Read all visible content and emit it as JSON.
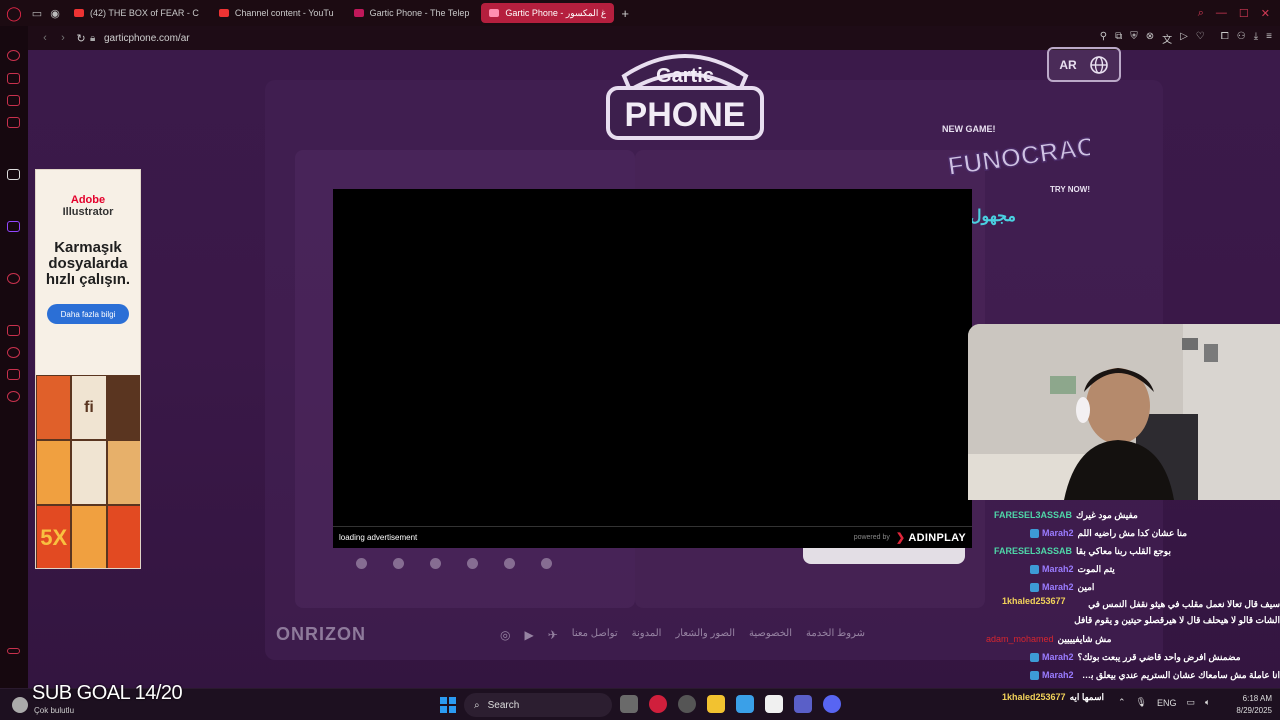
{
  "browser": {
    "tabs": [
      {
        "label": "(42) THE BOX of FEAR - C",
        "favicon": "youtube"
      },
      {
        "label": "Channel content - YouTu",
        "favicon": "youtube"
      },
      {
        "label": "Gartic Phone - The Telep",
        "favicon": "gartic"
      },
      {
        "label": "Gartic Phone - غ المكسور",
        "favicon": "gartic",
        "active": true
      }
    ],
    "url": "garticphone.com/ar"
  },
  "page": {
    "language_button": "AR",
    "logo_top": "Gartic",
    "logo_bottom": "PHONE",
    "promo": {
      "new_game": "NEW GAME!",
      "title": "FUNOCRACY",
      "cta": "TRY NOW!"
    },
    "arabic_name": "مجهول الهـ",
    "footer_brand": "ONRIZON",
    "footer_links": [
      "شروط الخدمة",
      "الخصوصية",
      "الصور والشعار",
      "المدونة",
      "تواصل معنا"
    ]
  },
  "side_ad": {
    "brand_line1": "Adobe",
    "brand_line2": "Illustrator",
    "headline": "Karmaşık dosyalarda hızlı çalışın.",
    "cta": "Daha fazla bilgi",
    "tile_labels": [
      "fi",
      "5X"
    ]
  },
  "video_ad": {
    "status": "loading advertisement",
    "powered_by": "powered by",
    "brand": "ADINPLAY"
  },
  "chat": [
    {
      "user": "FARESEL3ASSAB",
      "color": "#4fd6a8",
      "badge": false,
      "msg": "مفيش مود غيرك"
    },
    {
      "user": "Marah2",
      "color": "#9a7cff",
      "badge": true,
      "msg": "منا عشان كدا مش راضيه اللم"
    },
    {
      "user": "FARESEL3ASSAB",
      "color": "#4fd6a8",
      "badge": false,
      "msg": "بوجع القلب ربنا معاكي بقا"
    },
    {
      "user": "Marah2",
      "color": "#9a7cff",
      "badge": true,
      "msg": "يتم الموت"
    },
    {
      "user": "Marah2",
      "color": "#9a7cff",
      "badge": true,
      "msg": "امين"
    },
    {
      "user": "1khaled253677",
      "color": "#f2d25a",
      "badge": false,
      "msg": "سيف قال تعالا نعمل مقلب في هيثو نقفل النمس في الشات قالو لا هيحلف قال لا هيرقصلو حيتين و يقوم قافل"
    },
    {
      "user": "adam_mohamed",
      "color": "#d6262f",
      "badge": false,
      "msg": "مش شايفيييين"
    },
    {
      "user": "Marah2",
      "color": "#9a7cff",
      "badge": true,
      "msg": "مضمنش افرض واحد قاضي قرر يبعت بوتك؟"
    },
    {
      "user": "Marah2",
      "color": "#9a7cff",
      "badge": true,
      "msg": "انا عاملة مش سامعاك عشان الستريم عندي بيعلق بسبب النت"
    },
    {
      "user": "1khaled253677",
      "color": "#f2d25a",
      "badge": false,
      "msg": "اسمها ايه"
    }
  ],
  "overlay": {
    "sub_goal": "SUB GOAL 14/20"
  },
  "taskbar": {
    "weather": "Çok bulutlu",
    "search": "Search",
    "lang": "ENG",
    "time": "6:18 AM",
    "date": "8/29/2025"
  }
}
